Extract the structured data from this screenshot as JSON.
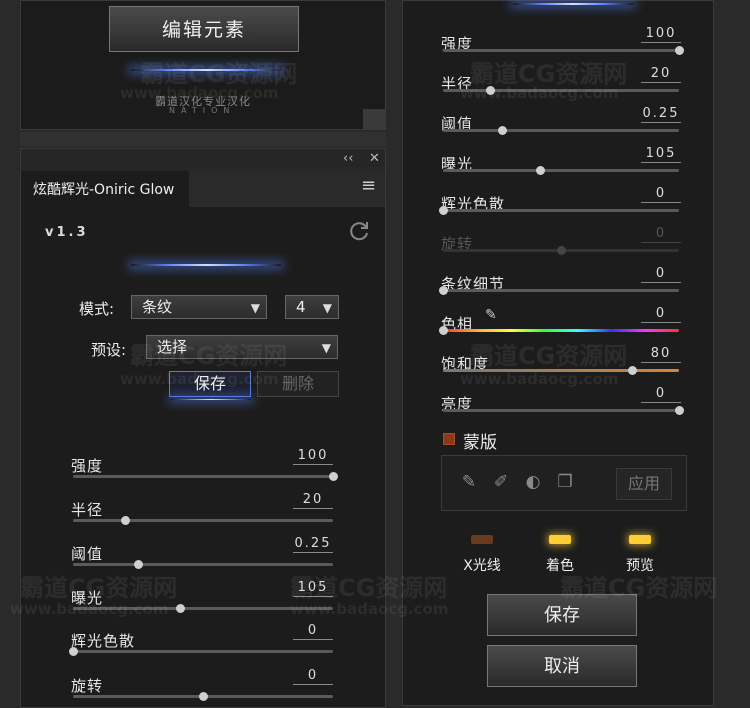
{
  "top_panel": {
    "edit_button": "编辑元素",
    "logo_text_cn": "霸道汉化专业汉化",
    "logo_text_en": "NATION",
    "logo_sub": "LOGO"
  },
  "left_panel": {
    "tab_title": "炫酷辉光-Oniric Glow",
    "collapse_glyph": "‹‹",
    "close_glyph": "✕",
    "menu_glyph": "≡",
    "version": "v1.3",
    "mode_label": "模式:",
    "mode_value": "条纹",
    "mode_count": "4",
    "preset_label": "预设:",
    "preset_value": "选择",
    "save_button": "保存",
    "delete_button": "删除",
    "sliders": [
      {
        "label": "强度",
        "value": "100",
        "level": 1.0
      },
      {
        "label": "半径",
        "value": "20",
        "level": 0.2
      },
      {
        "label": "阈值",
        "value": "0.25",
        "level": 0.25
      },
      {
        "label": "曝光",
        "value": "105",
        "level": 0.41
      },
      {
        "label": "辉光色散",
        "value": "0",
        "level": 0.0
      },
      {
        "label": "旋转",
        "value": "0",
        "level": 0.5
      }
    ]
  },
  "right_panel": {
    "sliders": [
      {
        "label": "强度",
        "value": "100",
        "level": 1.0,
        "enabled": true
      },
      {
        "label": "半径",
        "value": "20",
        "level": 0.2,
        "enabled": true
      },
      {
        "label": "阈值",
        "value": "0.25",
        "level": 0.25,
        "enabled": true
      },
      {
        "label": "曝光",
        "value": "105",
        "level": 0.41,
        "enabled": true
      },
      {
        "label": "辉光色散",
        "value": "0",
        "level": 0.0,
        "enabled": true
      },
      {
        "label": "旋转",
        "value": "0",
        "level": 0.5,
        "enabled": false
      },
      {
        "label": "条纹细节",
        "value": "0",
        "level": 0.0,
        "enabled": true
      },
      {
        "label": "色相",
        "value": "0",
        "level": 0.0,
        "enabled": true
      },
      {
        "label": "饱和度",
        "value": "80",
        "level": 0.8,
        "enabled": true
      },
      {
        "label": "亮度",
        "value": "0",
        "level": 1.0,
        "enabled": true
      }
    ],
    "mask_label": "蒙版",
    "apply_button": "应用",
    "toggles": [
      {
        "label": "X光线",
        "on": false
      },
      {
        "label": "着色",
        "on": true
      },
      {
        "label": "预览",
        "on": true
      }
    ],
    "save_button": "保存",
    "cancel_button": "取消"
  },
  "watermark": {
    "cn": "霸道CG资源网",
    "url": "www.badaocg.com"
  },
  "colors": {
    "accent_glow": "#5a86ff",
    "toggle_on": "#ffcc33",
    "toggle_off": "#6a3a1c",
    "mask_checkbox": "#8a3a1a"
  }
}
